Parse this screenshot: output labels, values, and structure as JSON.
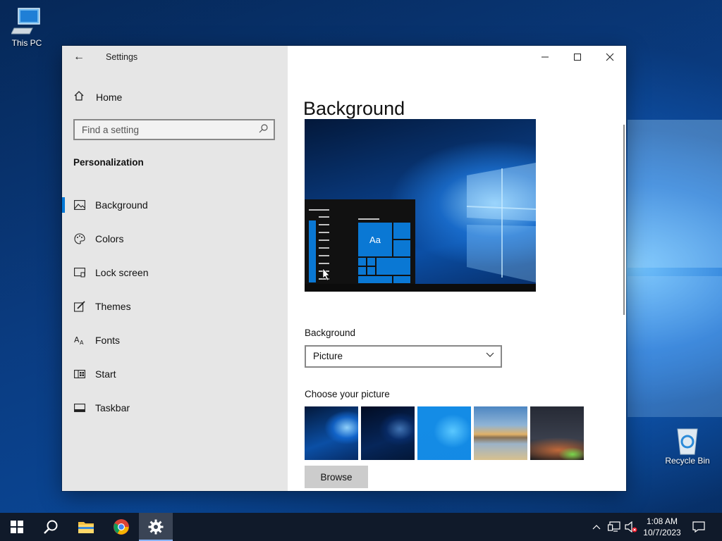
{
  "desktop": {
    "icons": [
      {
        "label": "This PC"
      },
      {
        "label": "Recycle Bin"
      }
    ]
  },
  "window": {
    "app_title": "Settings",
    "home_label": "Home",
    "search_placeholder": "Find a setting",
    "section_heading": "Personalization",
    "nav_items": [
      {
        "label": "Background",
        "icon": "picture-icon",
        "active": true
      },
      {
        "label": "Colors",
        "icon": "palette-icon",
        "active": false
      },
      {
        "label": "Lock screen",
        "icon": "lock-screen-icon",
        "active": false
      },
      {
        "label": "Themes",
        "icon": "brush-icon",
        "active": false
      },
      {
        "label": "Fonts",
        "icon": "fonts-icon",
        "active": false
      },
      {
        "label": "Start",
        "icon": "start-icon",
        "active": false
      },
      {
        "label": "Taskbar",
        "icon": "taskbar-icon",
        "active": false
      }
    ],
    "page_title": "Background",
    "preview_tile_text": "Aa",
    "background_label": "Background",
    "background_value": "Picture",
    "choose_picture_label": "Choose your picture",
    "browse_label": "Browse"
  },
  "taskbar": {
    "clock_time": "1:08 AM",
    "clock_date": "10/7/2023"
  },
  "colors": {
    "accent": "#0078d7",
    "sidebar_bg": "#e6e6e6",
    "taskbar_bg": "#101a2a"
  }
}
